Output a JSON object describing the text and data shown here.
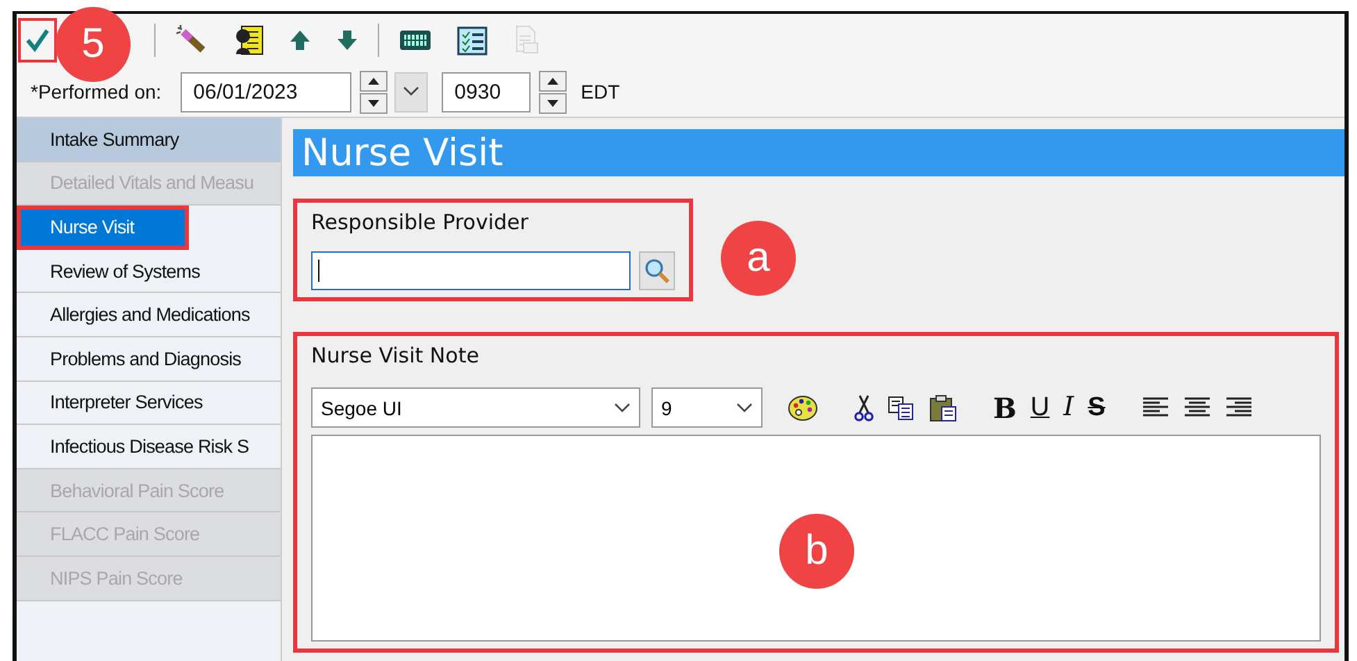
{
  "toolbar": {
    "buttons": [
      {
        "kind": "check",
        "disabled": false,
        "outlined": true
      },
      {
        "kind": "separator"
      },
      {
        "kind": "wand",
        "disabled": false,
        "outlined": false
      },
      {
        "kind": "person",
        "disabled": false,
        "outlined": false
      },
      {
        "kind": "up",
        "disabled": false,
        "outlined": false
      },
      {
        "kind": "down",
        "disabled": false,
        "outlined": false
      },
      {
        "kind": "separator"
      },
      {
        "kind": "keyboard",
        "disabled": false,
        "outlined": false
      },
      {
        "kind": "checklist",
        "disabled": false,
        "outlined": false
      },
      {
        "kind": "document",
        "disabled": true,
        "outlined": false
      }
    ]
  },
  "performed": {
    "label": "*Performed on:",
    "date": "06/01/2023",
    "time": "0930",
    "zone": "EDT"
  },
  "sidebar": {
    "items": [
      {
        "label": "Intake Summary",
        "selected": false,
        "disabled": false,
        "highlighted": true,
        "outlined": false
      },
      {
        "label": "Detailed Vitals and Measu",
        "selected": false,
        "disabled": true,
        "highlighted": false,
        "outlined": false
      },
      {
        "label": "Nurse Visit",
        "selected": true,
        "disabled": false,
        "highlighted": false,
        "outlined": true
      },
      {
        "label": "Review of Systems",
        "selected": false,
        "disabled": false,
        "highlighted": false,
        "outlined": false
      },
      {
        "label": "Allergies and Medications",
        "selected": false,
        "disabled": false,
        "highlighted": false,
        "outlined": false
      },
      {
        "label": "Problems and Diagnosis",
        "selected": false,
        "disabled": false,
        "highlighted": false,
        "outlined": false
      },
      {
        "label": "Interpreter Services",
        "selected": false,
        "disabled": false,
        "highlighted": false,
        "outlined": false
      },
      {
        "label": "Infectious Disease Risk S",
        "selected": false,
        "disabled": false,
        "highlighted": false,
        "outlined": false
      },
      {
        "label": "Behavioral Pain Score",
        "selected": false,
        "disabled": true,
        "highlighted": false,
        "outlined": false
      },
      {
        "label": "FLACC Pain Score",
        "selected": false,
        "disabled": true,
        "highlighted": false,
        "outlined": false
      },
      {
        "label": "NIPS Pain Score",
        "selected": false,
        "disabled": true,
        "highlighted": false,
        "outlined": false
      }
    ]
  },
  "panel": {
    "title": "Nurse Visit",
    "provider": {
      "label": "Responsible Provider",
      "outlined": true
    },
    "note": {
      "label": "Nurse Visit Note",
      "outlined": true,
      "font": "Segoe UI",
      "size": "9",
      "tools": [
        {
          "kind": "palette"
        },
        {
          "kind": "cut"
        },
        {
          "kind": "copy"
        },
        {
          "kind": "paste"
        },
        {
          "kind": "bold",
          "label": "B"
        },
        {
          "kind": "underline",
          "label": "U"
        },
        {
          "kind": "italic",
          "label": "I"
        },
        {
          "kind": "strike",
          "label": "S"
        },
        {
          "kind": "align-left"
        },
        {
          "kind": "align-center"
        },
        {
          "kind": "align-right"
        }
      ]
    }
  },
  "annotations": [
    {
      "label": "5"
    },
    {
      "label": "a"
    },
    {
      "label": "b"
    }
  ]
}
